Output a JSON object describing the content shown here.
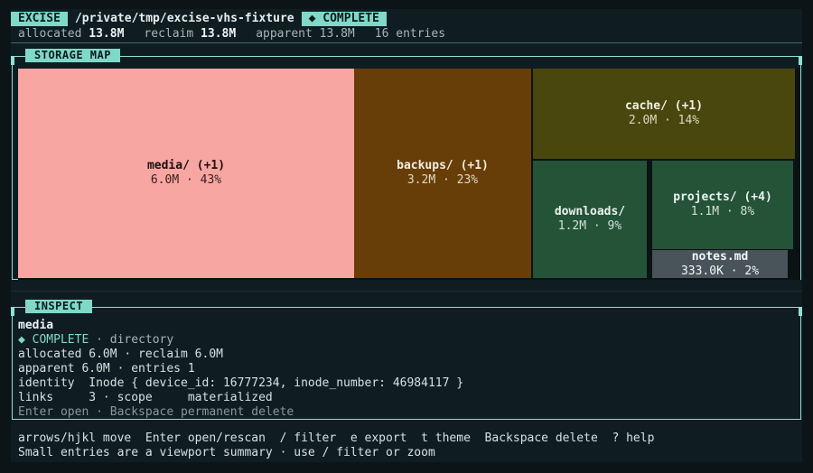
{
  "header": {
    "app_label": "EXCISE",
    "path": "/private/tmp/excise-vhs-fixture",
    "status": "◆ COMPLETE",
    "allocated_label": "allocated",
    "allocated_value": "13.8M",
    "reclaim_label": "reclaim",
    "reclaim_value": "13.8M",
    "apparent_text": "apparent 13.8M",
    "entries_text": "16 entries"
  },
  "storage_map": {
    "title": "STORAGE MAP",
    "tiles": [
      {
        "name": "media/ (+1)",
        "meta": "6.0M · 43%",
        "bg": "#f7a6a2",
        "fg": "#1c1010",
        "metafg": "#3a2020"
      },
      {
        "name": "backups/ (+1)",
        "meta": "3.2M · 23%",
        "bg": "#673e08",
        "fg": "#f3ede4",
        "metafg": "#e0d6c8"
      },
      {
        "name": "cache/ (+1)",
        "meta": "2.0M · 14%",
        "bg": "#4a470e",
        "fg": "#f1f1e4",
        "metafg": "#dad9c4"
      },
      {
        "name": "downloads/",
        "meta": "1.2M · 9%",
        "bg": "#245338",
        "fg": "#eaf3ee",
        "metafg": "#cfe1d7"
      },
      {
        "name": "projects/ (+4)",
        "meta": "1.1M · 8%",
        "bg": "#245338",
        "fg": "#eaf3ee",
        "metafg": "#cfe1d7"
      },
      {
        "name": "notes.md",
        "meta": "333.0K · 2%",
        "bg": "#48545a",
        "fg": "#f4f7f7",
        "metafg": "#f4f7f7"
      }
    ]
  },
  "inspect": {
    "title": "INSPECT",
    "name": "media",
    "status": "◆ COMPLETE",
    "type": " · directory",
    "line_alloc": "allocated 6.0M · reclaim 6.0M",
    "line_apparent": "apparent 6.0M · entries 1",
    "line_identity": "identity  Inode { device_id: 16777234, inode_number: 46984117 }",
    "line_links": "links     3 · scope     materialized",
    "hint": "Enter open · Backspace permanent delete"
  },
  "footer": {
    "keys": "arrows/hjkl move  Enter open/rescan  / filter  e export  t theme  Backspace delete  ? help",
    "note": "Small entries are a viewport summary · use / filter or zoom"
  },
  "colors": {
    "accent": "#7fd9c8",
    "background": "#0f1d22"
  }
}
